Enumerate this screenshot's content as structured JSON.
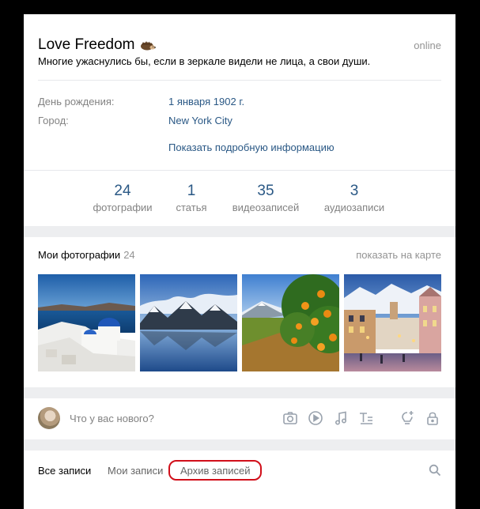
{
  "profile": {
    "name": "Love Freedom",
    "online": "online",
    "status": "Многие ужаснулись бы, если в зеркале видели не лица, а свои души.",
    "info": [
      {
        "label": "День рождения:",
        "value": "1 января 1902 г."
      },
      {
        "label": "Город:",
        "value": "New York City"
      }
    ],
    "more_link": "Показать подробную информацию",
    "counters": [
      {
        "num": "24",
        "label": "фотографии"
      },
      {
        "num": "1",
        "label": "статья"
      },
      {
        "num": "35",
        "label": "видеозаписей"
      },
      {
        "num": "3",
        "label": "аудиозаписи"
      }
    ]
  },
  "photos": {
    "title": "Мои фотографии",
    "count": "24",
    "map_link": "показать на карте"
  },
  "composer": {
    "placeholder": "Что у вас нового?",
    "tools": [
      "camera-icon",
      "video-icon",
      "music-icon",
      "article-icon",
      "idea-icon",
      "lock-icon"
    ]
  },
  "tabs": {
    "all": "Все записи",
    "mine": "Мои записи",
    "archive": "Архив записей"
  },
  "colors": {
    "link": "#2a5885",
    "highlight": "#d10f1a",
    "page_bg": "#edeef0"
  }
}
